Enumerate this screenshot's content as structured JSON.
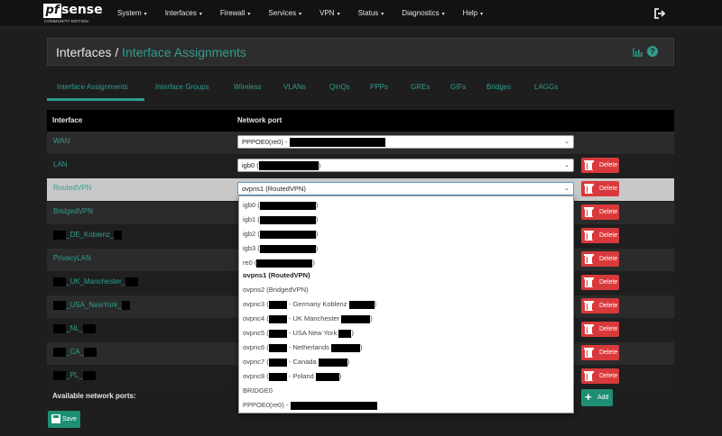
{
  "brand": {
    "logo_pf": "pf",
    "logo_sense": "sense",
    "edition": "COMMUNITY EDITION"
  },
  "nav": {
    "items": [
      "System",
      "Interfaces",
      "Firewall",
      "Services",
      "VPN",
      "Status",
      "Diagnostics",
      "Help"
    ],
    "caret": "▾"
  },
  "breadcrumb": {
    "root": "Interfaces",
    "separator": " / ",
    "current": "Interface Assignments"
  },
  "tabs": [
    "Interface Assignments",
    "Interface Groups",
    "Wireless",
    "VLANs",
    "QinQs",
    "PPPs",
    "GREs",
    "GIFs",
    "Bridges",
    "LAGGs"
  ],
  "table": {
    "headers": {
      "interface": "Interface",
      "network_port": "Network port"
    },
    "rows": [
      {
        "name": "WAN",
        "port": "PPPOE0(re0) - "
      },
      {
        "name": "LAN",
        "port": "igb0 (",
        "port_suffix": ")"
      },
      {
        "name": "RoutedVPN",
        "port": "ovpns1 (RoutedVPN)"
      },
      {
        "name": "BridgedVPN"
      },
      {
        "name": "_DE_Koblenz_"
      },
      {
        "name": "PrivacyLAN"
      },
      {
        "name": "_UK_Manchester_"
      },
      {
        "name": "_USA_NewYork_"
      },
      {
        "name": "_NL_"
      },
      {
        "name": "_CA_"
      },
      {
        "name": "_PL_"
      }
    ],
    "delete_label": "Delete"
  },
  "dropdown": {
    "options": [
      {
        "pre": "igb0 (",
        "post": ")"
      },
      {
        "pre": "igb1 (",
        "post": ")"
      },
      {
        "pre": "igb2 (",
        "post": ")"
      },
      {
        "pre": "igb3 (",
        "post": ")"
      },
      {
        "pre": "re0 (",
        "post": ")"
      },
      {
        "pre": "ovpns1 (RoutedVPN)",
        "post": ""
      },
      {
        "pre": "ovpns2 (BridgedVPN)",
        "post": ""
      },
      {
        "pre": "ovpnc3 (",
        "mid": " - Germany Koblenz ",
        "post": ")"
      },
      {
        "pre": "ovpnc4 (",
        "mid": " - UK Manchester ",
        "post": ")"
      },
      {
        "pre": "ovpnc5 (",
        "mid": " - USA New York ",
        "post": ")"
      },
      {
        "pre": "ovpnc6 (",
        "mid": " - Netherlands ",
        "post": ")"
      },
      {
        "pre": "ovpnc7 (",
        "mid": " - Canada ",
        "post": ")"
      },
      {
        "pre": "ovpnc8 (",
        "mid": " - Poland ",
        "post": ")"
      },
      {
        "pre": "BRIDGE0",
        "post": ""
      },
      {
        "pre": "PPPOE0(re0) - ",
        "post": ""
      }
    ],
    "selected_index": 5
  },
  "available_label": "Available network ports:",
  "add_label": "Add",
  "save_label": "Save",
  "colors": {
    "accent": "#2f9e8f",
    "danger": "#d9393b",
    "success": "#1f8f74"
  },
  "icons": {
    "logout": "sign-out-icon",
    "chart": "bar-chart-icon",
    "help": "question-circle-icon",
    "trash": "trash-icon",
    "plus": "plus-icon",
    "save": "floppy-disk-icon"
  }
}
